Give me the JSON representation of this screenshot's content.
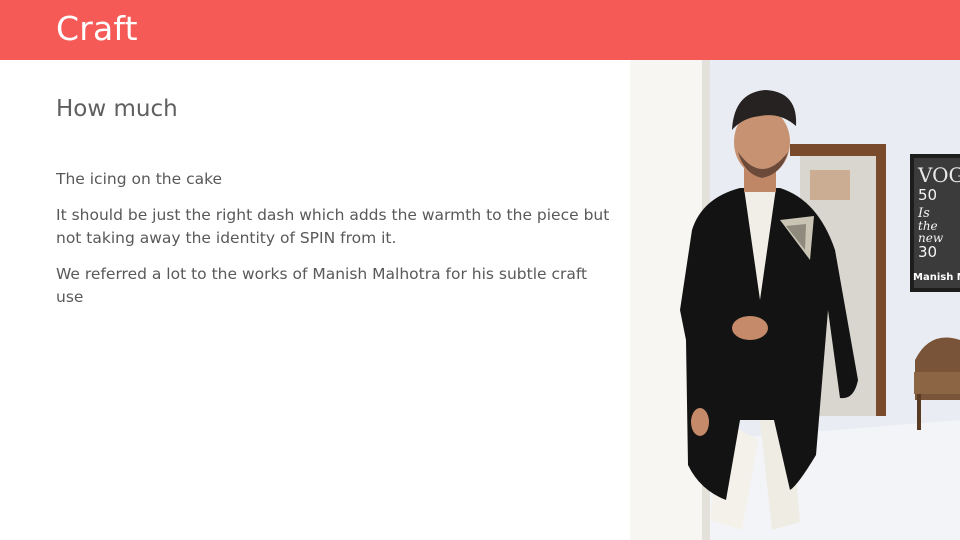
{
  "slide": {
    "title": "Craft",
    "subtitle": "How much",
    "paragraphs": [
      "The icing on the cake",
      "It should be just the right dash which adds the warmth to the piece but not taking away the identity of SPIN from it.",
      "We referred a lot to the works of Manish Malhotra for his subtle craft use"
    ]
  },
  "photo": {
    "poster_lines": [
      "VOG",
      "50",
      "Is",
      "the",
      "new",
      "30",
      "Manish M"
    ]
  },
  "colors": {
    "header_bg": "#f55a56",
    "header_text": "#ffffff",
    "body_text": "#595959"
  }
}
